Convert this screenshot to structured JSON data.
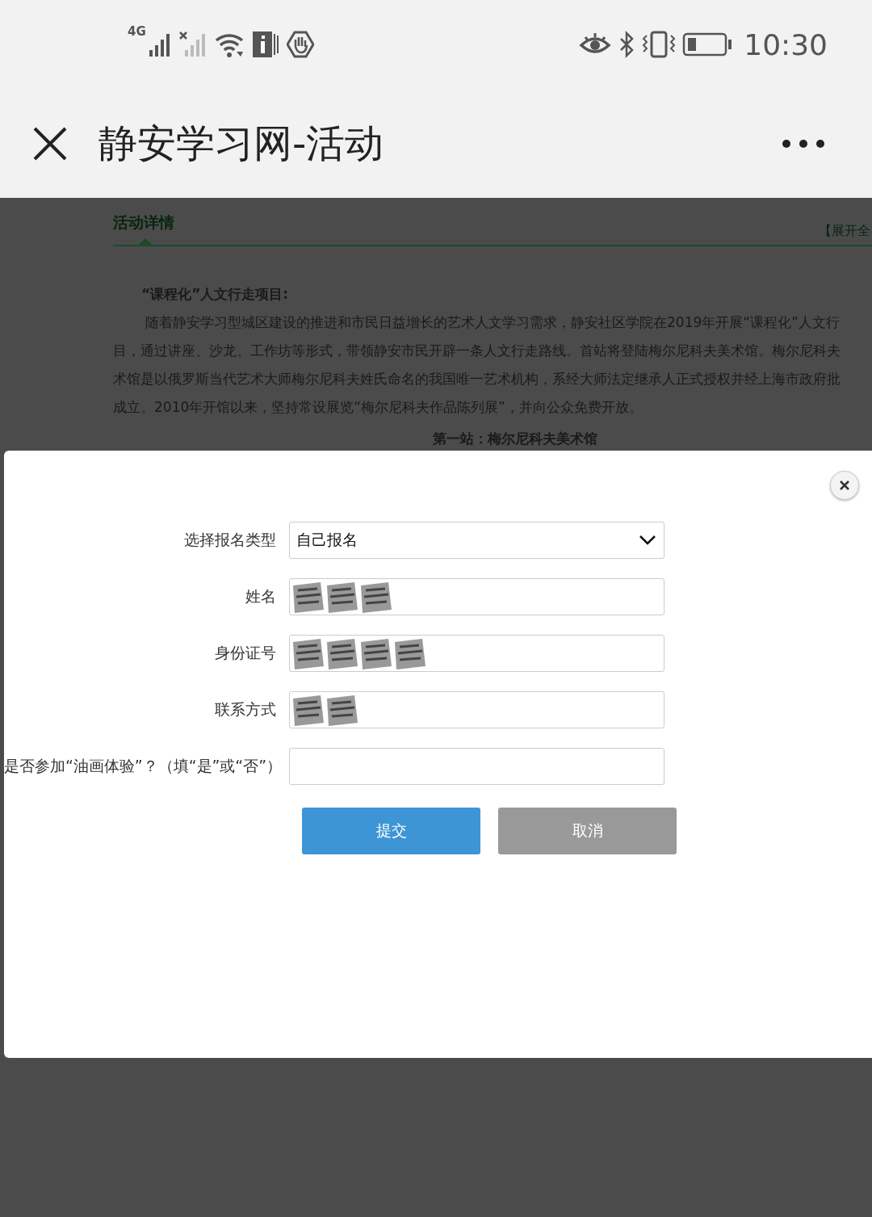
{
  "status_bar": {
    "time": "10:30",
    "network": "4G"
  },
  "title_bar": {
    "title": "静安学习网-活动"
  },
  "page": {
    "tab": "活动详情",
    "expand_link": "【展开全",
    "heading": "“课程化”人文行走项目:",
    "lines": [
      "随着静安学习型城区建设的推进和市民日益增长的艺术人文学习需求，静安社区学院在2019年开展“课程化”人文行",
      "目，通过讲座、沙龙、工作坊等形式，带领静安市民开辟一条人文行走路线。首站将登陆梅尔尼科夫美术馆。梅尔尼科夫",
      "术馆是以俄罗斯当代艺术大师梅尔尼科夫姓氏命名的我国唯一艺术机构，系经大师法定继承人正式授权并经上海市政府批",
      "成立。2010年开馆以来，坚持常设展览“梅尔尼科夫作品陈列展”，并向公众免费开放。"
    ],
    "subheading": "第一站：梅尔尼科夫美术馆"
  },
  "dialog": {
    "fields": [
      {
        "label": "选择报名类型",
        "kind": "select",
        "value": "自己报名"
      },
      {
        "label": "姓名",
        "kind": "text",
        "redacted": true
      },
      {
        "label": "身份证号",
        "kind": "text",
        "redacted": true
      },
      {
        "label": "联系方式",
        "kind": "text",
        "redacted": true
      },
      {
        "label": "是否参加“油画体验”？（填“是”或“否”）",
        "kind": "text",
        "redacted": false
      }
    ],
    "buttons": [
      {
        "label": "提交",
        "kind": "primary"
      },
      {
        "label": "取消",
        "kind": "secondary"
      }
    ]
  }
}
